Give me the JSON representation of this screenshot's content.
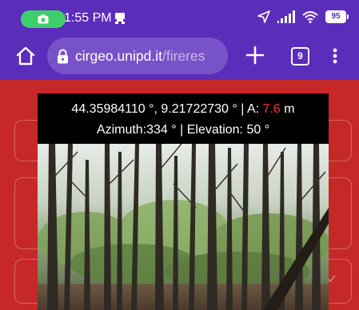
{
  "status_bar": {
    "time": "1:55 PM",
    "battery": "95",
    "icons": [
      "camera-icon",
      "notification-icon",
      "navigation-icon",
      "signal-icon",
      "wifi-icon",
      "battery-icon"
    ]
  },
  "browser": {
    "url_host": "cirgeo.unipd.it",
    "url_path": "/fireres",
    "tab_count": "9",
    "icons": [
      "home-icon",
      "lock-icon",
      "plus-icon",
      "tabs-icon",
      "more-vert-icon"
    ]
  },
  "overlay": {
    "lat": "44.35984110 °,",
    "lon": "9.21722730 °",
    "sep": "|",
    "accuracy_label": "A:",
    "accuracy_value": "7.6",
    "accuracy_unit": "m",
    "azimuth_text": "Azimuth:334 °",
    "elevation_text": "Elevation: 50 °"
  },
  "colors": {
    "toolbar": "#5b2dbb",
    "page_bg": "#c62828",
    "accent": "#ff2a2a",
    "camera_pill": "#3ecf6a"
  }
}
